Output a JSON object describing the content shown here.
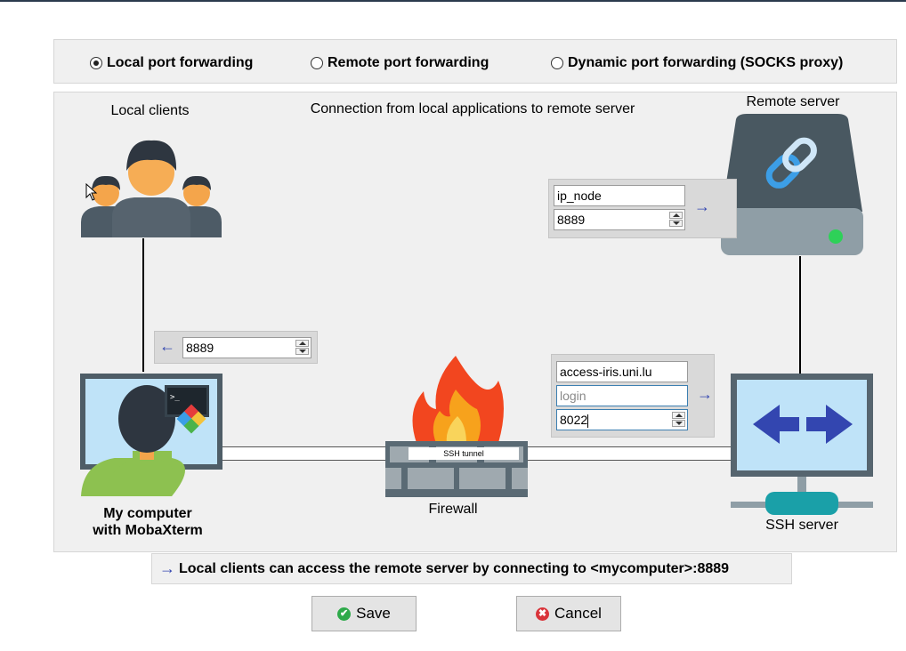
{
  "modes": {
    "local": "Local port forwarding",
    "remote": "Remote port forwarding",
    "dynamic": "Dynamic port forwarding (SOCKS proxy)",
    "selected": "local"
  },
  "diagram": {
    "local_clients_label": "Local clients",
    "description": "Connection from local applications to remote server",
    "remote_server_label": "Remote server",
    "my_computer_line1": "My computer",
    "my_computer_line2": "with MobaXterm",
    "firewall_label": "Firewall",
    "ssh_server_label": "SSH server",
    "ssh_tunnel_label": "SSH tunnel"
  },
  "remote_target": {
    "host": "ip_node",
    "port": "8889"
  },
  "local_port": {
    "port": "8889"
  },
  "ssh_server": {
    "host": "access-iris.uni.lu",
    "login_placeholder": "login",
    "port": "8022"
  },
  "info_text": "Local clients can access the remote server by connecting to <mycomputer>:8889",
  "buttons": {
    "save": "Save",
    "cancel": "Cancel"
  },
  "colors": {
    "arrow": "#3346b0",
    "save_icon": "#2eaa4a",
    "cancel_icon": "#d9343a"
  }
}
